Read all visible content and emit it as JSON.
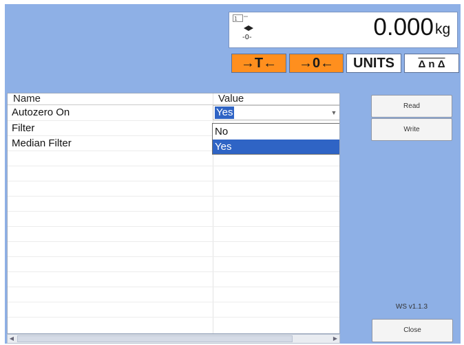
{
  "display": {
    "weight": "0.000",
    "unit": "kg",
    "zero_symbol": "-0-"
  },
  "function_keys": {
    "tare_label": "→T←",
    "zero_label": "→0←",
    "units_label": "UNITS",
    "scale_select_label": "Δ n Δ"
  },
  "table": {
    "headers": {
      "name": "Name",
      "value": "Value"
    },
    "rows": [
      {
        "name": "Autozero On",
        "value": "Yes"
      },
      {
        "name": "Filter",
        "value": ""
      },
      {
        "name": "Median Filter",
        "value": ""
      }
    ],
    "dropdown_options": [
      "No",
      "Yes"
    ],
    "selected_option": "Yes"
  },
  "buttons": {
    "read_label": "Read",
    "write_label": "Write",
    "close_label": "Close"
  },
  "version": "WS v1.1.3",
  "colors": {
    "background": "#8eb0e6",
    "key_active": "#ff8f1e",
    "selection": "#2f64c5"
  }
}
